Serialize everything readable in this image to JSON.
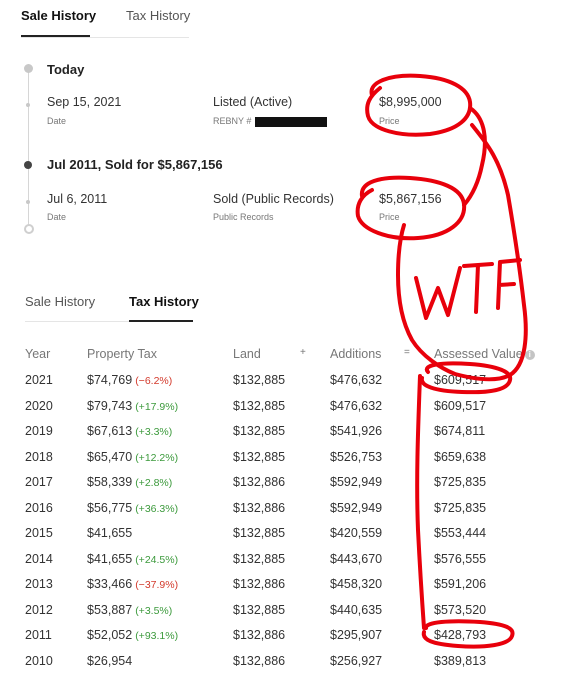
{
  "sale_history_panel": {
    "tabs": [
      {
        "label": "Sale History",
        "active": true
      },
      {
        "label": "Tax History",
        "active": false
      }
    ],
    "groups": [
      {
        "title": "Today",
        "events": [
          {
            "date": "Sep 15, 2021",
            "date_label": "Date",
            "event": "Listed (Active)",
            "source": "REBNY #",
            "price": "$8,995,000",
            "price_label": "Price"
          }
        ]
      },
      {
        "title": "Jul 2011, Sold for $5,867,156",
        "events": [
          {
            "date": "Jul 6, 2011",
            "date_label": "Date",
            "event": "Sold (Public Records)",
            "source": "Public Records",
            "price": "$5,867,156",
            "price_label": "Price"
          }
        ]
      }
    ]
  },
  "tax_history_panel": {
    "tabs": [
      {
        "label": "Sale History",
        "active": false
      },
      {
        "label": "Tax History",
        "active": true
      }
    ],
    "columns": {
      "year": "Year",
      "tax": "Property Tax",
      "land": "Land",
      "plus": "+",
      "additions": "Additions",
      "equals": "=",
      "assessed": "Assessed Value",
      "info_icon": "i"
    },
    "rows": [
      {
        "year": "2021",
        "tax": "$74,769",
        "change": "(−6.2%)",
        "dir": "down",
        "land": "$132,885",
        "additions": "$476,632",
        "assessed": "$609,517"
      },
      {
        "year": "2020",
        "tax": "$79,743",
        "change": "(+17.9%)",
        "dir": "up",
        "land": "$132,885",
        "additions": "$476,632",
        "assessed": "$609,517"
      },
      {
        "year": "2019",
        "tax": "$67,613",
        "change": "(+3.3%)",
        "dir": "up",
        "land": "$132,885",
        "additions": "$541,926",
        "assessed": "$674,811"
      },
      {
        "year": "2018",
        "tax": "$65,470",
        "change": "(+12.2%)",
        "dir": "up",
        "land": "$132,885",
        "additions": "$526,753",
        "assessed": "$659,638"
      },
      {
        "year": "2017",
        "tax": "$58,339",
        "change": "(+2.8%)",
        "dir": "up",
        "land": "$132,886",
        "additions": "$592,949",
        "assessed": "$725,835"
      },
      {
        "year": "2016",
        "tax": "$56,775",
        "change": "(+36.3%)",
        "dir": "up",
        "land": "$132,886",
        "additions": "$592,949",
        "assessed": "$725,835"
      },
      {
        "year": "2015",
        "tax": "$41,655",
        "change": "",
        "dir": "",
        "land": "$132,885",
        "additions": "$420,559",
        "assessed": "$553,444"
      },
      {
        "year": "2014",
        "tax": "$41,655",
        "change": "(+24.5%)",
        "dir": "up",
        "land": "$132,885",
        "additions": "$443,670",
        "assessed": "$576,555"
      },
      {
        "year": "2013",
        "tax": "$33,466",
        "change": "(−37.9%)",
        "dir": "down",
        "land": "$132,886",
        "additions": "$458,320",
        "assessed": "$591,206"
      },
      {
        "year": "2012",
        "tax": "$53,887",
        "change": "(+3.5%)",
        "dir": "up",
        "land": "$132,885",
        "additions": "$440,635",
        "assessed": "$573,520"
      },
      {
        "year": "2011",
        "tax": "$52,052",
        "change": "(+93.1%)",
        "dir": "up",
        "land": "$132,886",
        "additions": "$295,907",
        "assessed": "$428,793"
      },
      {
        "year": "2010",
        "tax": "$26,954",
        "change": "",
        "dir": "",
        "land": "$132,886",
        "additions": "$256,927",
        "assessed": "$389,813"
      }
    ]
  },
  "annotation": {
    "text": "WTF",
    "color": "#e8000b"
  },
  "colors": {
    "positive": "#3c9a3c",
    "negative": "#d33a2c"
  }
}
